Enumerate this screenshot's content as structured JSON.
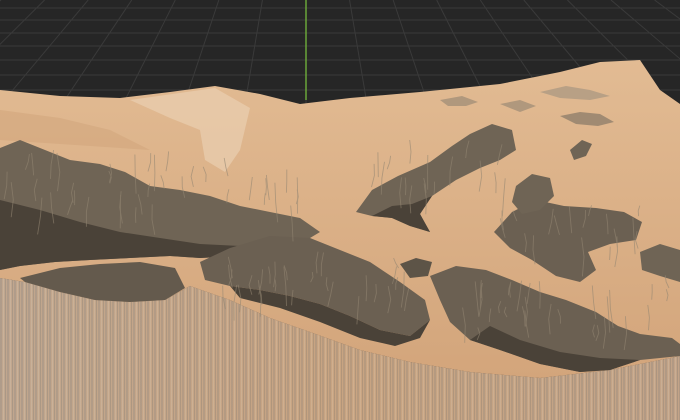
{
  "viewport": {
    "view": "3d-viewport",
    "colors": {
      "background": "#262626",
      "grid_line": "#3a3a3a",
      "axis_y": "#6fae3a",
      "sand": "#d9ac82",
      "sand_light": "#e6c29c",
      "sand_dark": "#b98f69",
      "rock": "#6f6455",
      "rock_dark": "#4a4238",
      "rock_light": "#938672"
    },
    "icons": {
      "grid": "floor-grid",
      "axis": "y-axis-line",
      "terrain": "terrain-mesh"
    }
  }
}
